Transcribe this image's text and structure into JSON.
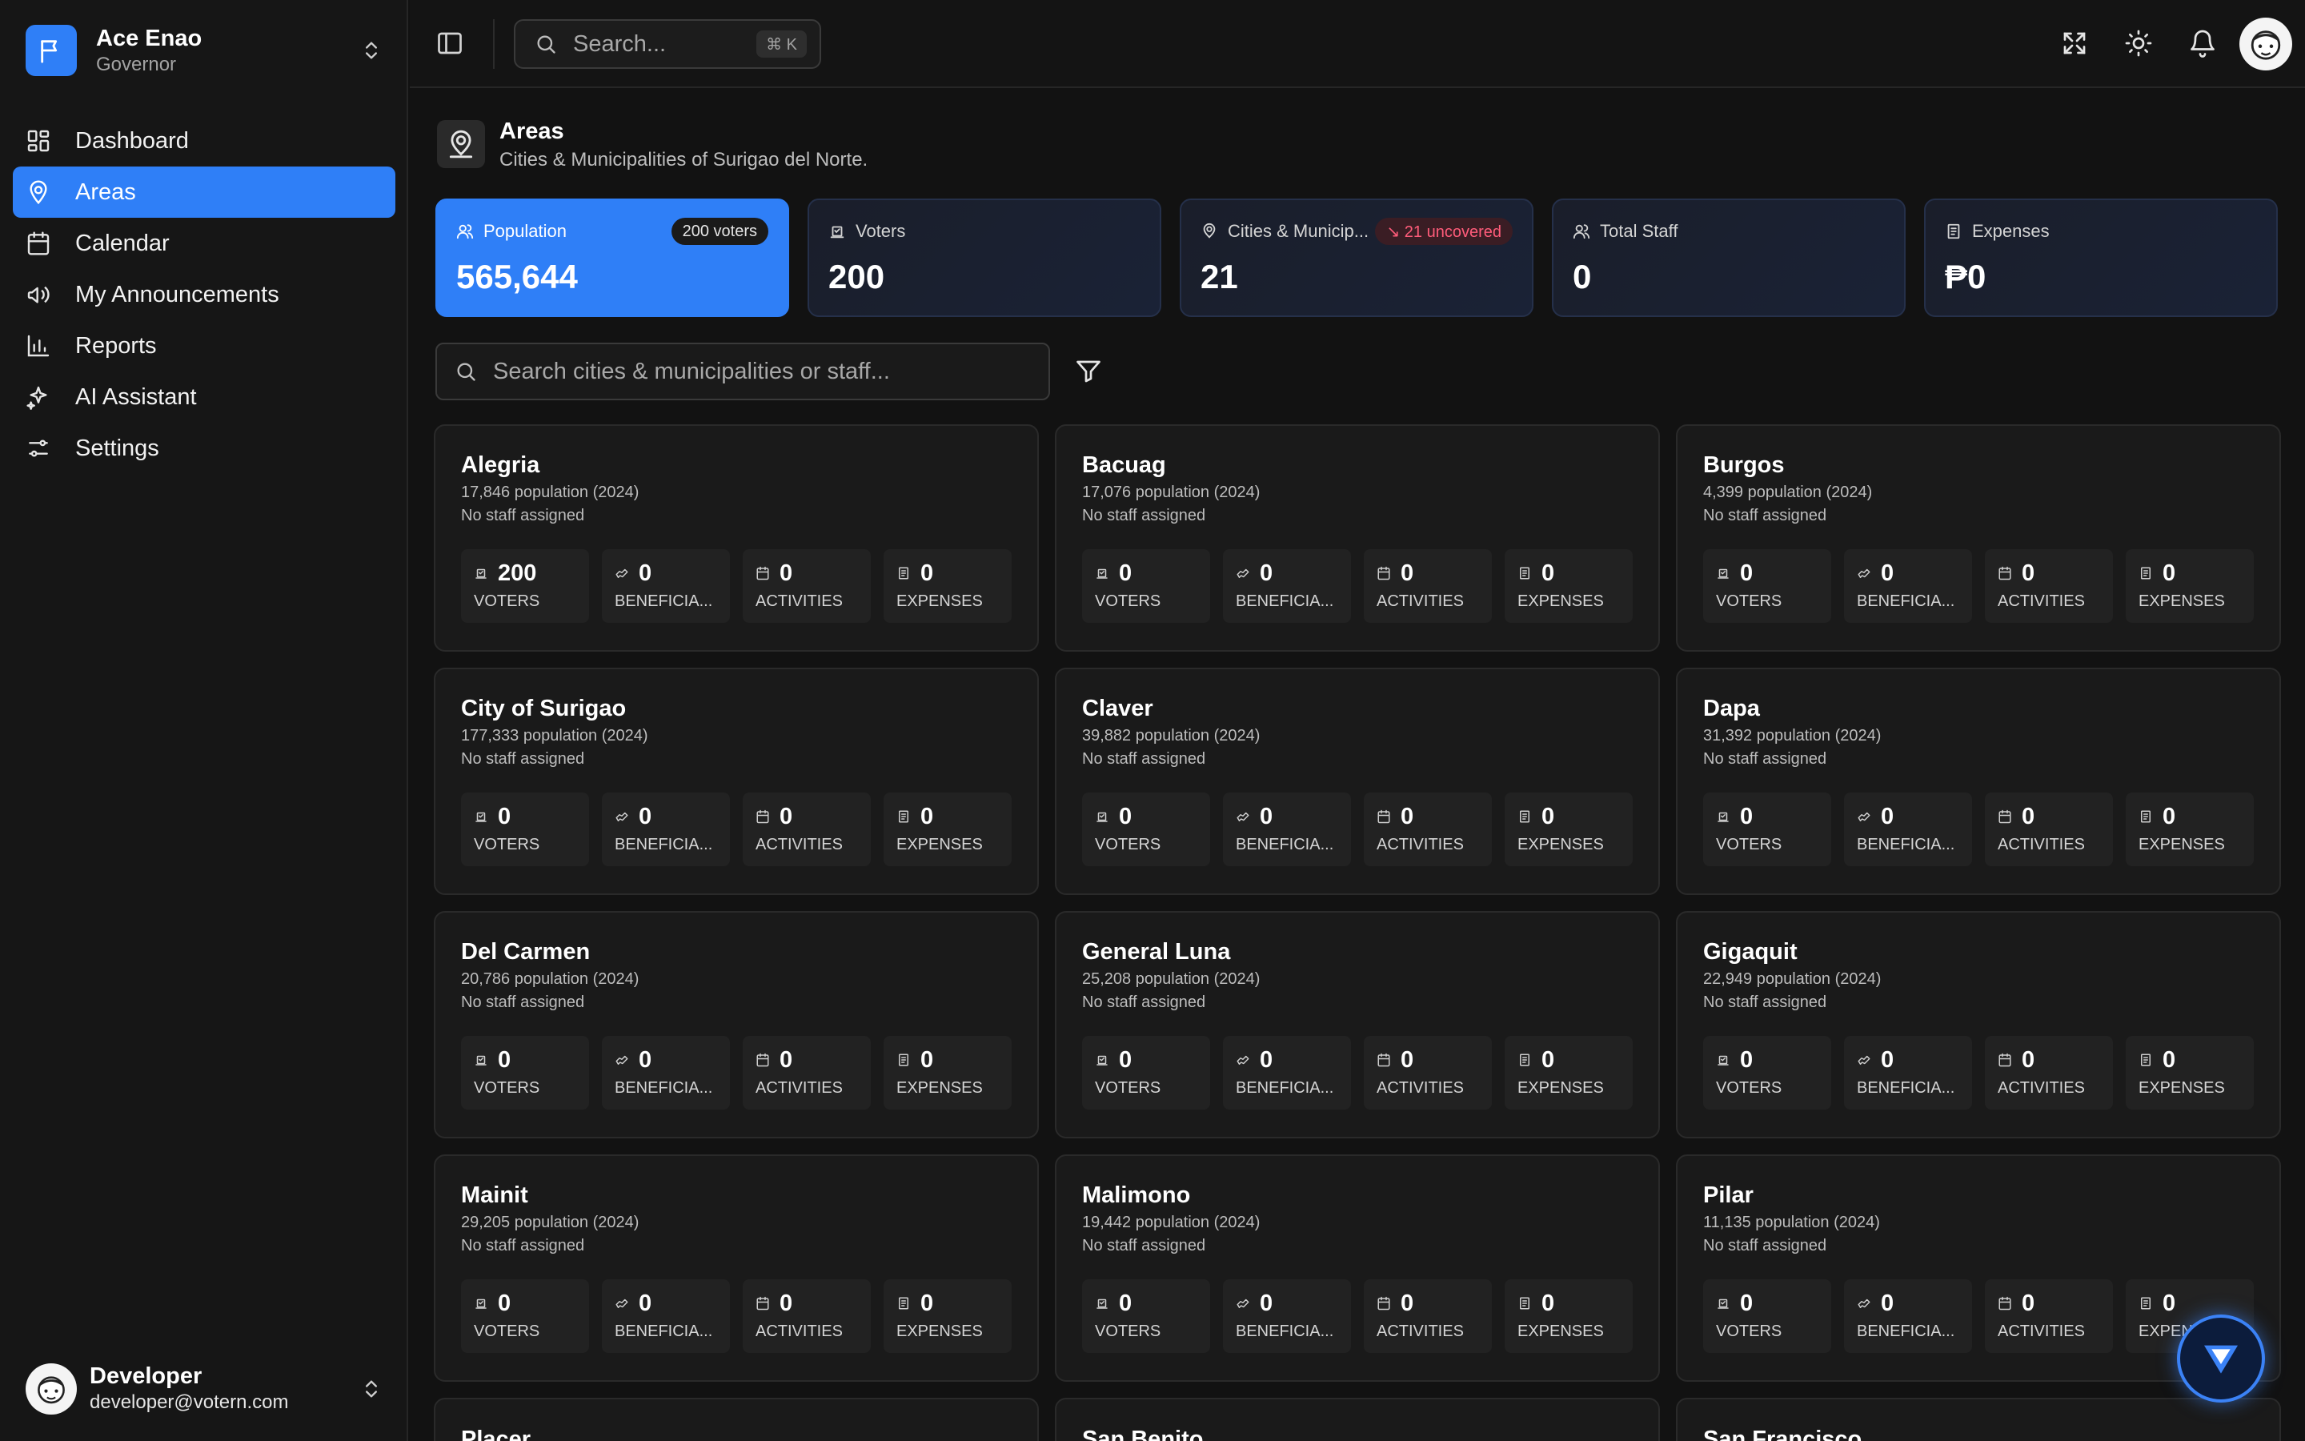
{
  "org": {
    "name": "Ace Enao",
    "role": "Governor"
  },
  "nav": [
    {
      "label": "Dashboard",
      "icon": "dashboard-icon"
    },
    {
      "label": "Areas",
      "icon": "map-pin-icon",
      "active": true
    },
    {
      "label": "Calendar",
      "icon": "calendar-icon"
    },
    {
      "label": "My Announcements",
      "icon": "megaphone-icon"
    },
    {
      "label": "Reports",
      "icon": "bar-chart-icon"
    },
    {
      "label": "AI Assistant",
      "icon": "sparkles-icon"
    },
    {
      "label": "Settings",
      "icon": "sliders-icon"
    }
  ],
  "user": {
    "name": "Developer",
    "email": "developer@votern.com"
  },
  "topbar": {
    "search_placeholder": "Search...",
    "shortcut": "⌘ K"
  },
  "page": {
    "title": "Areas",
    "subtitle": "Cities & Municipalities of Surigao del Norte."
  },
  "stats": [
    {
      "label": "Population",
      "value": "565,644",
      "badge": "200 voters",
      "badge_style": "dark",
      "icon": "users-icon"
    },
    {
      "label": "Voters",
      "value": "200",
      "icon": "ballot-icon"
    },
    {
      "label": "Cities & Municip...",
      "value": "21",
      "badge": "↘ 21 uncovered",
      "badge_style": "red",
      "icon": "map-pin-icon"
    },
    {
      "label": "Total Staff",
      "value": "0",
      "icon": "users-icon"
    },
    {
      "label": "Expenses",
      "value": "₱0",
      "icon": "receipt-icon"
    }
  ],
  "filter": {
    "placeholder": "Search cities & municipalities or staff..."
  },
  "metric_labels": [
    "VOTERS",
    "BENEFICIA...",
    "ACTIVITIES",
    "EXPENSES"
  ],
  "areas": [
    {
      "name": "Alegria",
      "population": "17,846 population (2024)",
      "staff": "No staff assigned",
      "metrics": [
        "200",
        "0",
        "0",
        "0"
      ]
    },
    {
      "name": "Bacuag",
      "population": "17,076 population (2024)",
      "staff": "No staff assigned",
      "metrics": [
        "0",
        "0",
        "0",
        "0"
      ]
    },
    {
      "name": "Burgos",
      "population": "4,399 population (2024)",
      "staff": "No staff assigned",
      "metrics": [
        "0",
        "0",
        "0",
        "0"
      ]
    },
    {
      "name": "City of Surigao",
      "population": "177,333 population (2024)",
      "staff": "No staff assigned",
      "metrics": [
        "0",
        "0",
        "0",
        "0"
      ]
    },
    {
      "name": "Claver",
      "population": "39,882 population (2024)",
      "staff": "No staff assigned",
      "metrics": [
        "0",
        "0",
        "0",
        "0"
      ]
    },
    {
      "name": "Dapa",
      "population": "31,392 population (2024)",
      "staff": "No staff assigned",
      "metrics": [
        "0",
        "0",
        "0",
        "0"
      ]
    },
    {
      "name": "Del Carmen",
      "population": "20,786 population (2024)",
      "staff": "No staff assigned",
      "metrics": [
        "0",
        "0",
        "0",
        "0"
      ]
    },
    {
      "name": "General Luna",
      "population": "25,208 population (2024)",
      "staff": "No staff assigned",
      "metrics": [
        "0",
        "0",
        "0",
        "0"
      ]
    },
    {
      "name": "Gigaquit",
      "population": "22,949 population (2024)",
      "staff": "No staff assigned",
      "metrics": [
        "0",
        "0",
        "0",
        "0"
      ]
    },
    {
      "name": "Mainit",
      "population": "29,205 population (2024)",
      "staff": "No staff assigned",
      "metrics": [
        "0",
        "0",
        "0",
        "0"
      ]
    },
    {
      "name": "Malimono",
      "population": "19,442 population (2024)",
      "staff": "No staff assigned",
      "metrics": [
        "0",
        "0",
        "0",
        "0"
      ]
    },
    {
      "name": "Pilar",
      "population": "11,135 population (2024)",
      "staff": "No staff assigned",
      "metrics": [
        "0",
        "0",
        "0",
        "0"
      ]
    }
  ],
  "partial_areas": [
    "Placer",
    "San Benito",
    "San Francisco"
  ],
  "colors": {
    "accent": "#2f7ff7",
    "background": "#121212",
    "card": "#1a1a1a",
    "danger": "#ff5c7a"
  }
}
